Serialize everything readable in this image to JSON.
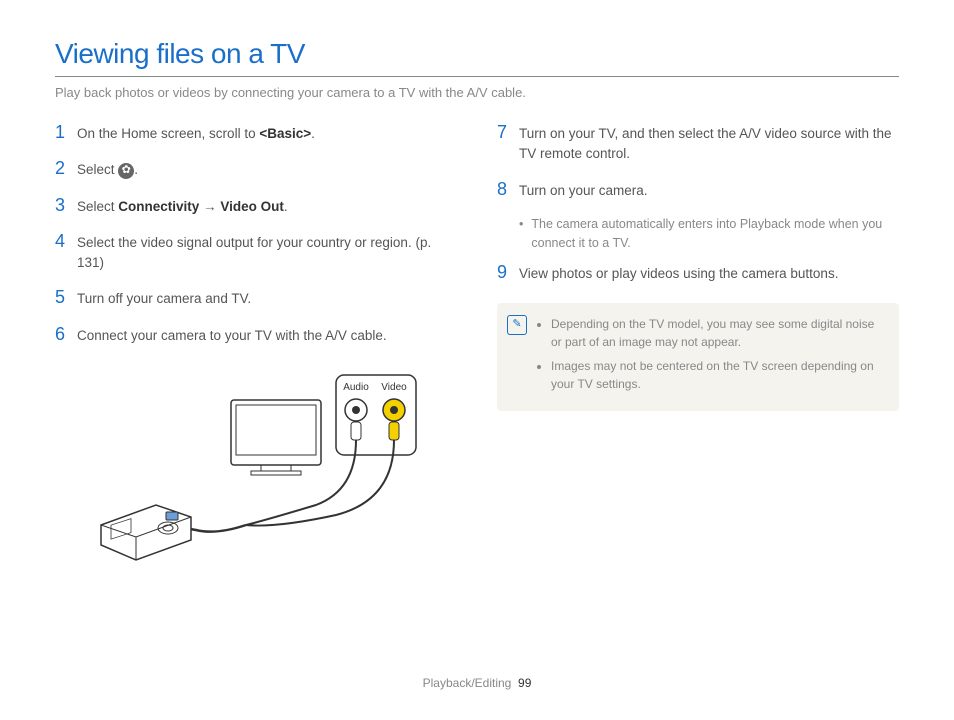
{
  "title": "Viewing files on a TV",
  "subtitle": "Play back photos or videos by connecting your camera to a TV with the A/V cable.",
  "left_steps": [
    {
      "num": "1",
      "text_pre": "On the Home screen, scroll to ",
      "bold": "<Basic>",
      "text_post": "."
    },
    {
      "num": "2",
      "text_pre": "Select ",
      "icon": "gear",
      "text_post": "."
    },
    {
      "num": "3",
      "text_pre": "Select ",
      "bold": "Connectivity",
      "arrow": " → ",
      "bold2": "Video Out",
      "text_post": "."
    },
    {
      "num": "4",
      "text": "Select the video signal output for your country or region. (p. 131)"
    },
    {
      "num": "5",
      "text": "Turn off your camera and TV."
    },
    {
      "num": "6",
      "text": "Connect your camera to your TV with the A/V cable."
    }
  ],
  "diagram_labels": {
    "audio": "Audio",
    "video": "Video"
  },
  "right_steps": [
    {
      "num": "7",
      "text": "Turn on your TV, and then select the A/V video source with the TV remote control."
    },
    {
      "num": "8",
      "text": "Turn on your camera.",
      "sub": "The camera automatically enters into Playback mode when you connect it to a TV."
    },
    {
      "num": "9",
      "text": "View photos or play videos using the camera buttons."
    }
  ],
  "notes": [
    "Depending on the TV model, you may see some digital noise or part of an image may not appear.",
    "Images may not be centered on the TV screen depending on your TV settings."
  ],
  "footer_section": "Playback/Editing",
  "footer_page": "99"
}
